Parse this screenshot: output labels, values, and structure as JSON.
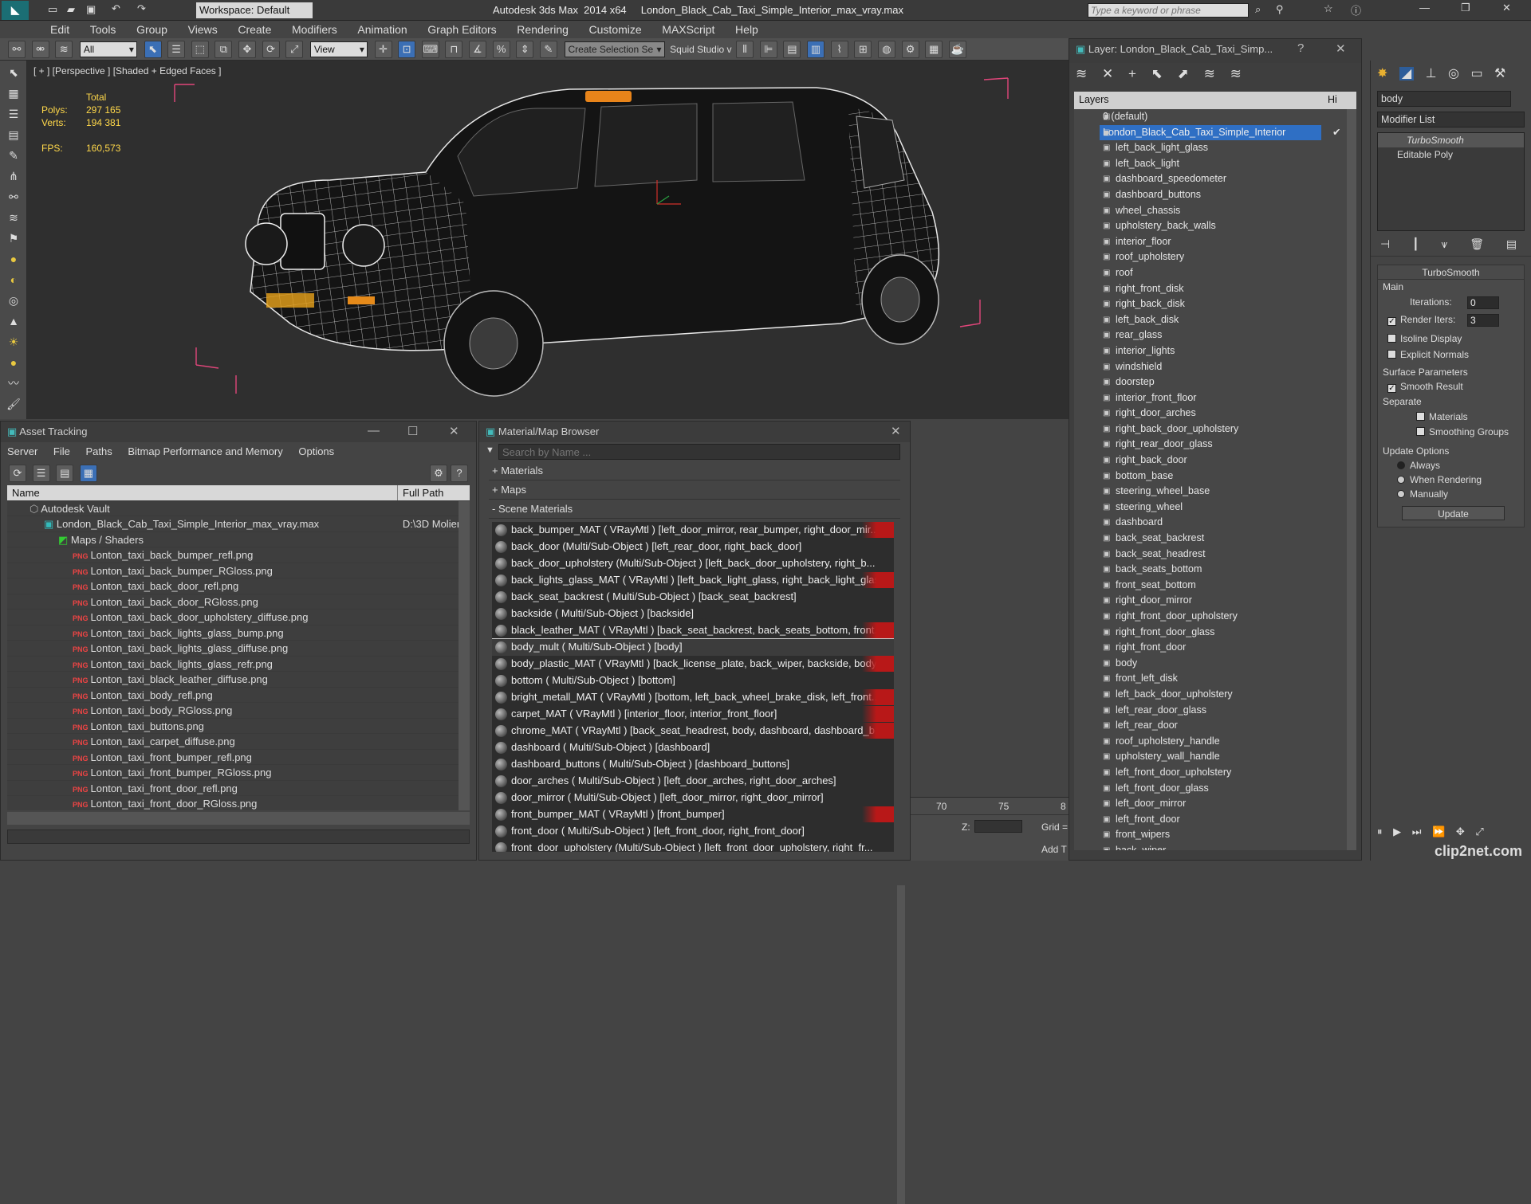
{
  "app": {
    "title": "Autodesk 3ds Max  2014 x64     London_Black_Cab_Taxi_Simple_Interior_max_vray.max",
    "workspace": "Workspace: Default",
    "search_placeholder": "Type a keyword or phrase"
  },
  "menu": [
    "Edit",
    "Tools",
    "Group",
    "Views",
    "Create",
    "Modifiers",
    "Animation",
    "Graph Editors",
    "Rendering",
    "Customize",
    "MAXScript",
    "Help"
  ],
  "toolbar": {
    "filter": "All",
    "view": "View",
    "selection_set": "Create Selection Se",
    "squid": "Squid Studio v"
  },
  "viewport": {
    "label": "[ + ] [Perspective ] [Shaded + Edged Faces ]",
    "stats_header": "Total",
    "polys_label": "Polys:",
    "polys_value": "297 165",
    "verts_label": "Verts:",
    "verts_value": "194 381",
    "fps_label": "FPS:",
    "fps_value": "160,573"
  },
  "asset_tracking": {
    "title": "Asset Tracking",
    "menu": [
      "Server",
      "File",
      "Paths",
      "Bitmap Performance and Memory",
      "Options"
    ],
    "col_name": "Name",
    "col_path": "Full Path",
    "vault": "Autodesk Vault",
    "file": "London_Black_Cab_Taxi_Simple_Interior_max_vray.max",
    "file_path": "D:\\3D Molier",
    "maps": "Maps / Shaders",
    "items": [
      "Lonton_taxi_back_bumper_refl.png",
      "Lonton_taxi_back_bumper_RGloss.png",
      "Lonton_taxi_back_door_refl.png",
      "Lonton_taxi_back_door_RGloss.png",
      "Lonton_taxi_back_door_upholstery_diffuse.png",
      "Lonton_taxi_back_lights_glass_bump.png",
      "Lonton_taxi_back_lights_glass_diffuse.png",
      "Lonton_taxi_back_lights_glass_refr.png",
      "Lonton_taxi_black_leather_diffuse.png",
      "Lonton_taxi_body_refl.png",
      "Lonton_taxi_body_RGloss.png",
      "Lonton_taxi_buttons.png",
      "Lonton_taxi_carpet_diffuse.png",
      "Lonton_taxi_front_bumper_refl.png",
      "Lonton_taxi_front_bumper_RGloss.png",
      "Lonton_taxi_front_door_refl.png",
      "Lonton_taxi_front_door_RGloss.png"
    ]
  },
  "material_browser": {
    "title": "Material/Map Browser",
    "search_placeholder": "Search by Name ...",
    "section_materials": "+ Materials",
    "section_maps": "+ Maps",
    "section_scene": "- Scene Materials",
    "items": [
      "back_bumper_MAT  ( VRayMtl )  [left_door_mirror, rear_bumper, right_door_mir...",
      "back_door  (Multi/Sub-Object )  [left_rear_door, right_back_door]",
      "back_door_upholstery  (Multi/Sub-Object ) [left_back_door_upholstery, right_b...",
      "back_lights_glass_MAT  ( VRayMtl )  [left_back_light_glass, right_back_light_glass]",
      "back_seat_backrest  ( Multi/Sub-Object )  [back_seat_backrest]",
      "backside  ( Multi/Sub-Object )  [backside]",
      "black_leather_MAT  ( VRayMtl )  [back_seat_backrest, back_seats_bottom, front...",
      "body_mult  ( Multi/Sub-Object )  [body]",
      "body_plastic_MAT  ( VRayMtl )  [back_license_plate, back_wiper, backside, body,...",
      "bottom  ( Multi/Sub-Object )  [bottom]",
      "bright_metall_MAT  ( VRayMtl )  [bottom, left_back_wheel_brake_disk, left_front...",
      "carpet_MAT  ( VRayMtl )  [interior_floor, interior_front_floor]",
      "chrome_MAT  ( VRayMtl )  [back_seat_headrest, body, dashboard, dashboard_b...",
      "dashboard  ( Multi/Sub-Object )  [dashboard]",
      "dashboard_buttons  ( Multi/Sub-Object )  [dashboard_buttons]",
      "door_arches  ( Multi/Sub-Object )  [left_door_arches, right_door_arches]",
      "door_mirror  ( Multi/Sub-Object )  [left_door_mirror, right_door_mirror]",
      "front_bumper_MAT  ( VRayMtl )  [front_bumper]",
      "front_door  ( Multi/Sub-Object )  [left_front_door, right_front_door]",
      "front_door_upholstery  (Multi/Sub-Object ) [left_front_door_upholstery, right_fr..."
    ]
  },
  "layers": {
    "title": "Layer: London_Black_Cab_Taxi_Simp...",
    "header": "Layers",
    "hide_col": "Hi",
    "default_layer": "0 (default)",
    "active_layer": "London_Black_Cab_Taxi_Simple_Interior",
    "items": [
      "left_back_light_glass",
      "left_back_light",
      "dashboard_speedometer",
      "dashboard_buttons",
      "wheel_chassis",
      "upholstery_back_walls",
      "interior_floor",
      "roof_upholstery",
      "roof",
      "right_front_disk",
      "right_back_disk",
      "left_back_disk",
      "rear_glass",
      "interior_lights",
      "windshield",
      "doorstep",
      "interior_front_floor",
      "right_door_arches",
      "right_back_door_upholstery",
      "right_rear_door_glass",
      "right_back_door",
      "bottom_base",
      "steering_wheel_base",
      "steering_wheel",
      "dashboard",
      "back_seat_backrest",
      "back_seat_headrest",
      "back_seats_bottom",
      "front_seat_bottom",
      "right_door_mirror",
      "right_front_door_upholstery",
      "right_front_door_glass",
      "right_front_door",
      "body",
      "front_left_disk",
      "left_back_door_upholstery",
      "left_rear_door_glass",
      "left_rear_door",
      "roof_upholstery_handle",
      "upholstery_wall_handle",
      "left_front_door_upholstery",
      "left_front_door_glass",
      "left_door_mirror",
      "left_front_door",
      "front_wipers",
      "back_wiper"
    ]
  },
  "command_panel": {
    "object_name": "body",
    "modifier_list": "Modifier List",
    "stack": [
      "TurboSmooth",
      "Editable Poly"
    ],
    "rollout_title": "TurboSmooth",
    "main": "Main",
    "iterations_label": "Iterations:",
    "iterations_value": "0",
    "render_iters_label": "Render Iters:",
    "render_iters_value": "3",
    "isoline": "Isoline Display",
    "explicit": "Explicit Normals",
    "surface_params": "Surface Parameters",
    "smooth_result": "Smooth Result",
    "separate": "Separate",
    "materials": "Materials",
    "smoothing_groups": "Smoothing Groups",
    "update_options": "Update Options",
    "always": "Always",
    "when_rendering": "When Rendering",
    "manually": "Manually",
    "update_btn": "Update"
  },
  "timeline": {
    "ticks": [
      "70",
      "75",
      "8"
    ],
    "z_label": "Z:",
    "grid_label": "Grid =",
    "add_t": "Add T"
  },
  "watermark": "clip2net.com"
}
